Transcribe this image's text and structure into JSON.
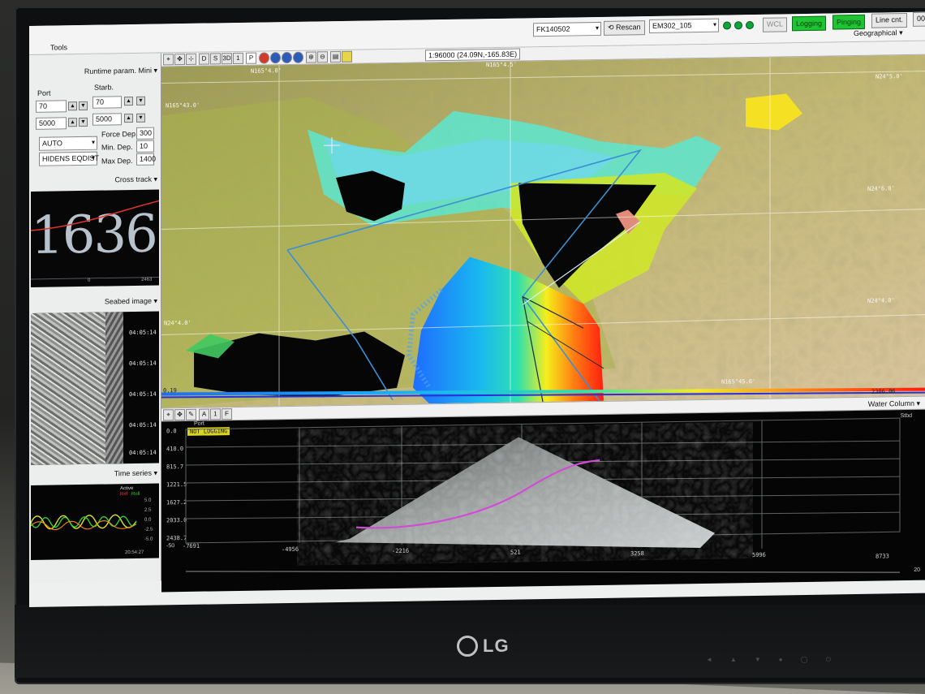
{
  "menu": {
    "tools": "Tools"
  },
  "toolbar": {
    "survey": "FK140502",
    "rescan": "Rescan",
    "sonar": "EM302_105",
    "wcl": "WCL",
    "logging": "Logging",
    "pinging": "Pinging",
    "line_cnt": "Line cnt.",
    "extra": "00",
    "projection": "Geographical"
  },
  "runtime": {
    "title": "Runtime param. Mini",
    "port_label": "Port",
    "starb_label": "Starb.",
    "port_angle": "70",
    "port_cov": "5000",
    "starb_angle": "70",
    "starb_cov": "5000",
    "mode": "AUTO",
    "detector": "HIDENS EQDIST",
    "force_depth_label": "Force Dep.",
    "force_depth": "300",
    "min_depth_label": "Min. Dep.",
    "min_depth": "10",
    "max_depth_label": "Max Dep.",
    "max_depth": "1400"
  },
  "crosstrack": {
    "title": "Cross track",
    "depth": "1636",
    "x_left": "0",
    "x_right": "2463"
  },
  "seabed": {
    "title": "Seabed image",
    "times": [
      "04:05:14",
      "04:05:14",
      "04:05:14",
      "04:05:14",
      "04:05:14"
    ]
  },
  "timeseries": {
    "title": "Time series",
    "legend_a": "Active",
    "legend_b": "Ref",
    "legend_c": "Roll",
    "ticks": [
      "5.0",
      "2.5",
      "0.0",
      "-2.5",
      "-5.0"
    ],
    "time": "20:54:27"
  },
  "map": {
    "scale": "1:96000 (24.09N,-165.83E)",
    "tool_labels": [
      "D",
      "S",
      "3D",
      "1",
      "P"
    ],
    "coords": [
      "N165°4.0'",
      "N165°4.5'",
      "N24°6.0'",
      "N24°5.0'",
      "N24°4.0'",
      "N165°43.0'",
      "N24°4.0'",
      "N165°45.0'"
    ],
    "depth_max": "2306.06",
    "depth_min": "0.19",
    "colors": {
      "shallow": "#ff1d10",
      "mid": "#f6ee1a",
      "deep": "#1f6cff",
      "shade": "#b8b36a"
    }
  },
  "water_column": {
    "title": "Water Column",
    "status": "NOT LOGGING",
    "port_label": "Port",
    "starb_label": "Stbd",
    "y_ticks": [
      "0.0",
      "410.0",
      "815.7",
      "1221.5",
      "1627.2",
      "2033.0",
      "2438.7"
    ],
    "x_ticks": [
      "-7691",
      "-4956",
      "-2216",
      "521",
      "3258",
      "5996",
      "8733"
    ],
    "footer_left": "-50",
    "footer_right": "20"
  },
  "brand": {
    "logo": "LG"
  }
}
